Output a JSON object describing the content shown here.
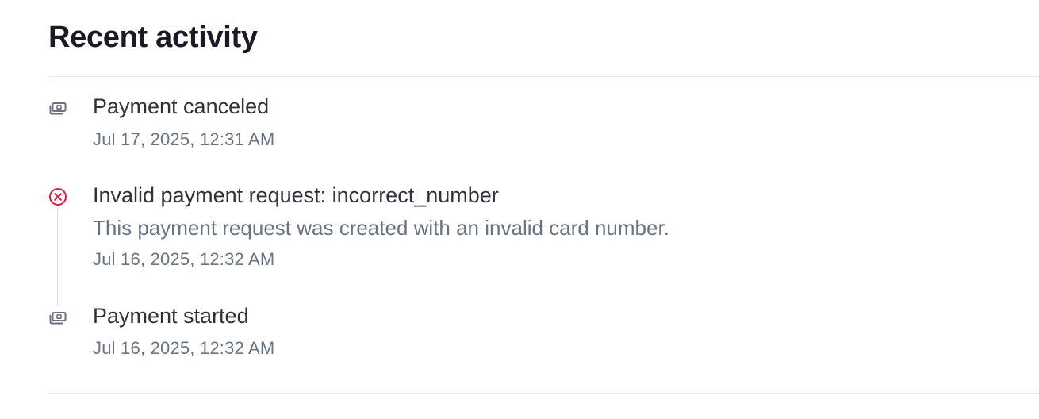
{
  "header": {
    "title": "Recent activity"
  },
  "activity": [
    {
      "icon": "payment-icon",
      "title": "Payment canceled",
      "time": "Jul 17, 2025, 12:31 AM"
    },
    {
      "icon": "error-circle-icon",
      "title": "Invalid payment request: incorrect_number",
      "description": "This payment request was created with an invalid card number.",
      "time": "Jul 16, 2025, 12:32 AM"
    },
    {
      "icon": "payment-icon",
      "title": "Payment started",
      "time": "Jul 16, 2025, 12:32 AM"
    }
  ],
  "colors": {
    "title": "#1a1b25",
    "text": "#30313d",
    "muted": "#6a7383",
    "error": "#df1b41",
    "icon": "#6a7383",
    "divider": "#e3e6ec"
  }
}
